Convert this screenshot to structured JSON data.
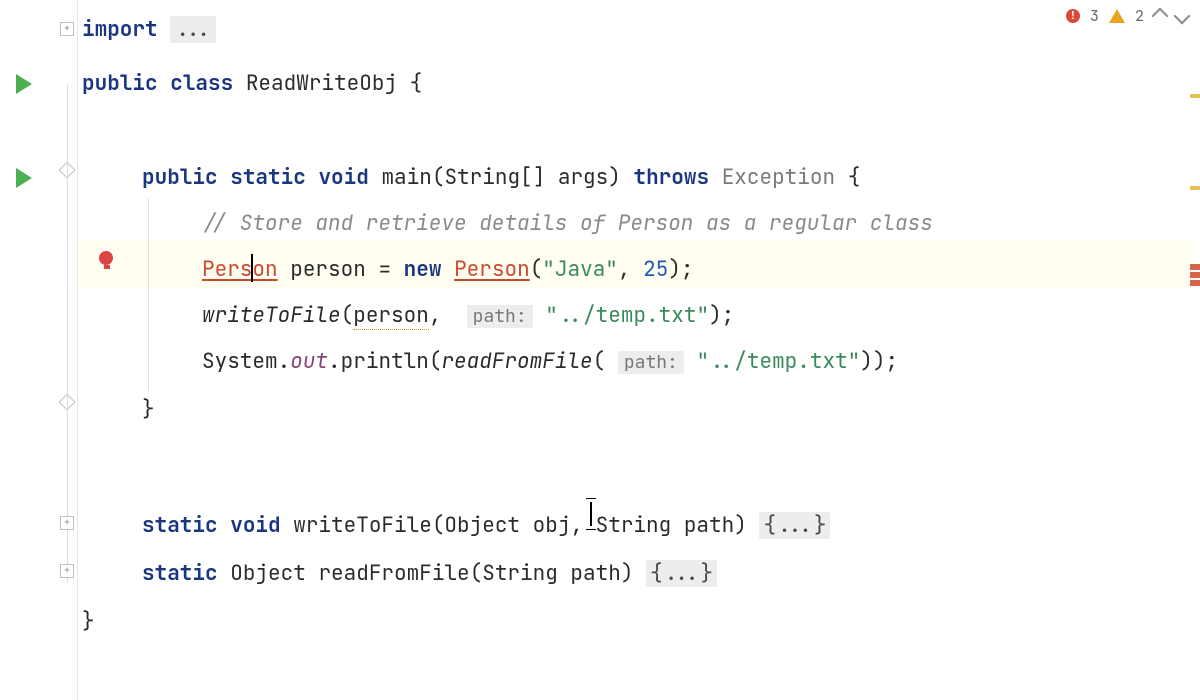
{
  "inspection": {
    "error_count": "3",
    "warning_count": "2"
  },
  "code": {
    "import_keyword": "import",
    "import_folded": "...",
    "class_decl_public": "public",
    "class_decl_class": "class",
    "class_name": "ReadWriteObj",
    "open_brace": "{",
    "main_public": "public",
    "main_static": "static",
    "main_void": "void",
    "main_name": "main(String[] args)",
    "main_throws": "throws",
    "main_exception": "Exception",
    "comment": "// Store and retrieve details of Person as a regular class",
    "person_type_left": "Pers",
    "person_type_right": "on",
    "person_var": "person",
    "eq": "=",
    "new_kw": "new",
    "person_ctor": "Person",
    "str_java": "\"Java\"",
    "num_25": "25",
    "write_call": "writeToFile",
    "write_arg1": "person",
    "hint_path": "path:",
    "path_value": "\"../temp.txt\"",
    "sys": "System",
    "out": "out",
    "println": "println",
    "read_call": "readFromFile",
    "close_brace": "}",
    "write_decl_static": "static",
    "write_decl_void": "void",
    "write_decl_sig": "writeToFile(Object obj, String path)",
    "folded_body": "{...}",
    "read_decl_static": "static",
    "read_decl_ret": "Object",
    "read_decl_sig": "readFromFile(String path)"
  }
}
